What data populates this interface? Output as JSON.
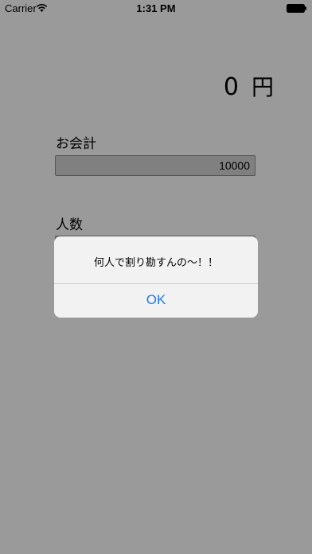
{
  "status_bar": {
    "carrier": "Carrier",
    "time": "1:31 PM",
    "wifi_icon": "wifi-icon",
    "battery_icon": "battery-icon"
  },
  "result": {
    "amount": "0",
    "unit": "円"
  },
  "bill": {
    "label": "お会計",
    "value": "10000"
  },
  "people": {
    "label": "人数",
    "value": ""
  },
  "alert": {
    "message": "何人で割り勘すんの〜！！",
    "ok_label": "OK"
  },
  "colors": {
    "background": "#9a9a9a",
    "alert_background": "#f2f2f2",
    "accent": "#1a7cf5"
  }
}
